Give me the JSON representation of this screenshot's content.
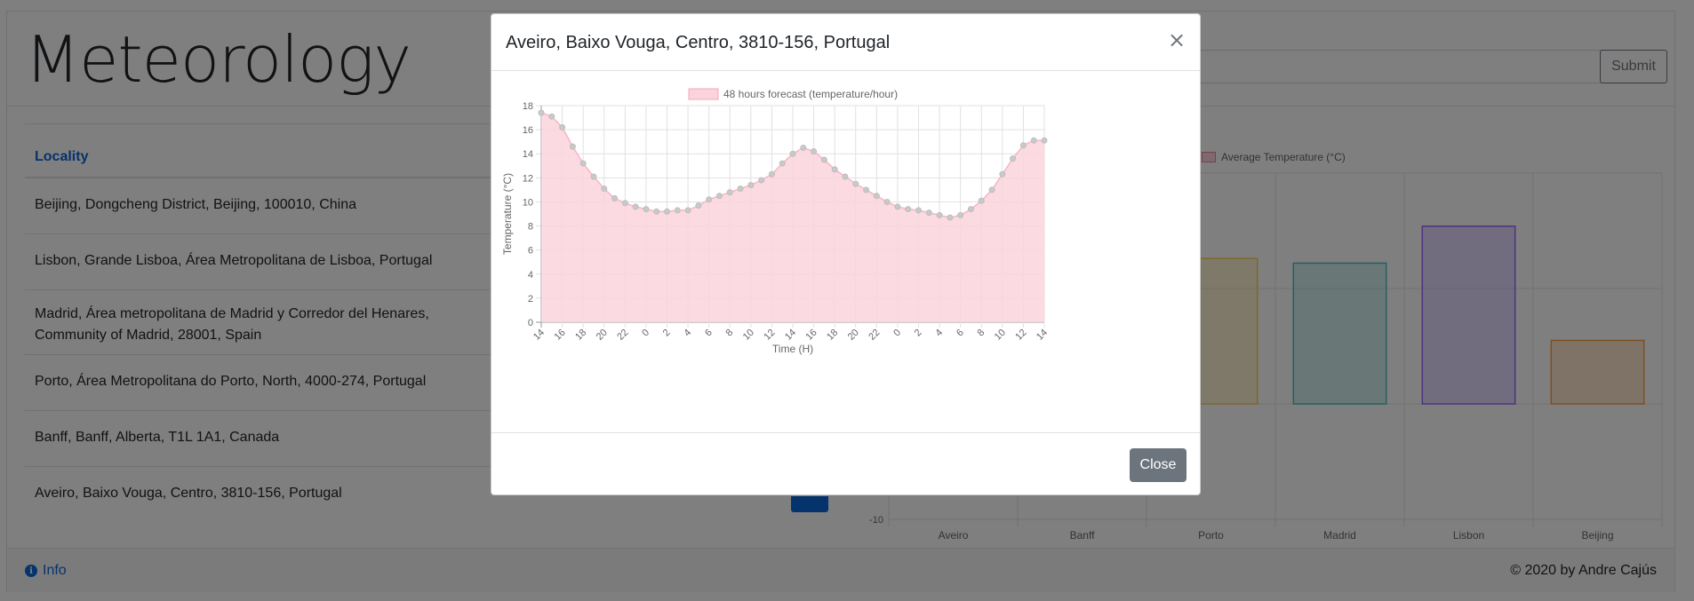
{
  "page": {
    "title": "Meteorology",
    "submit_label": "Submit",
    "table": {
      "header": "Locality",
      "rows": [
        "Beijing, Dongcheng District, Beijing, 100010, China",
        "Lisbon, Grande Lisboa, Área Metropolitana de Lisboa, Portugal",
        "Madrid, Área metropolitana de Madrid y Corredor del Henares,",
        "Community of Madrid, 28001, Spain",
        "Porto, Área Metropolitana do Porto, North, 4000-274, Portugal",
        "Banff, Banff, Alberta, T1L 1A1, Canada",
        "Aveiro, Baixo Vouga, Centro, 3810-156, Portugal"
      ]
    },
    "footer": {
      "info_label": "Info",
      "info_icon": "info-circle-icon",
      "copyright": "© 2020 by Andre Cajús"
    }
  },
  "colors": {
    "accent": "#0b66d6",
    "secondary": "#6c757d",
    "forecast_fill": "#fbd3dc",
    "forecast_point": "#c9c9c9"
  },
  "modal": {
    "title": "Aveiro, Baixo Vouga, Centro, 3810-156, Portugal",
    "close_label": "Close",
    "close_icon": "close-icon"
  },
  "chart_data": [
    {
      "type": "area",
      "legend": "48 hours forecast (temperature/hour)",
      "xlabel": "Time (H)",
      "ylabel": "Temperature (°C)",
      "ylim": [
        0,
        18
      ],
      "y_ticks": [
        0,
        2,
        4,
        6,
        8,
        10,
        12,
        14,
        16,
        18
      ],
      "x_tick_labels": [
        "14",
        "16",
        "18",
        "20",
        "22",
        "0",
        "2",
        "4",
        "6",
        "8",
        "10",
        "12",
        "14",
        "16",
        "18",
        "20",
        "22",
        "0",
        "2",
        "4",
        "6",
        "8",
        "10",
        "12",
        "14"
      ],
      "grid": true,
      "values": [
        17.4,
        17.1,
        16.2,
        14.6,
        13.2,
        12.1,
        11.1,
        10.3,
        9.9,
        9.6,
        9.4,
        9.2,
        9.2,
        9.3,
        9.3,
        9.7,
        10.2,
        10.5,
        10.8,
        11.1,
        11.4,
        11.8,
        12.3,
        13.2,
        14.0,
        14.5,
        14.2,
        13.5,
        12.7,
        12.1,
        11.5,
        11.0,
        10.5,
        10.0,
        9.6,
        9.4,
        9.3,
        9.1,
        8.9,
        8.7,
        8.9,
        9.4,
        10.1,
        11.0,
        12.3,
        13.6,
        14.7,
        15.1,
        15.1
      ]
    },
    {
      "type": "bar",
      "legend": "Average Temperature (°C)",
      "categories": [
        "Aveiro",
        "Banff",
        "Porto",
        "Madrid",
        "Lisbon",
        "Beijing"
      ],
      "visible_y_tick": -10,
      "bar_colors": [
        "#ff6384",
        "#ff9f40",
        "#ffcd56",
        "#4bc0c0",
        "#9966ff",
        "#ff9f40"
      ],
      "values": [
        null,
        null,
        12.6,
        12.2,
        15.4,
        5.5
      ],
      "note": ""
    }
  ]
}
